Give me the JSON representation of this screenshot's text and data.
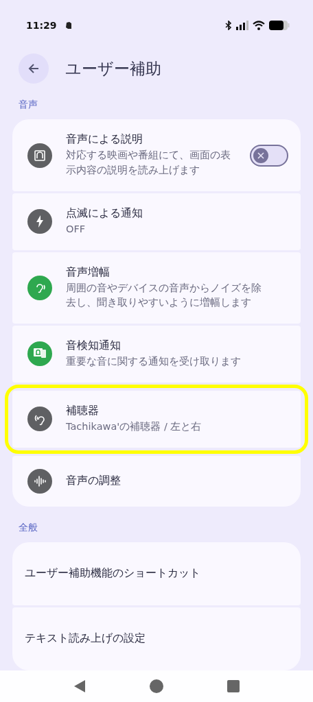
{
  "status_bar": {
    "time": "11:29"
  },
  "header": {
    "title": "ユーザー補助"
  },
  "sections": [
    {
      "title": "音声",
      "items": [
        {
          "title": "音声による説明",
          "subtitle": "対応する映画や番組にて、画面の表示内容の説明を読み上げます",
          "color": "#5f6063",
          "toggle": {
            "checked": false
          },
          "highlighted": false
        },
        {
          "title": "点滅による通知",
          "subtitle": "OFF",
          "color": "#5f6063",
          "highlighted": false
        },
        {
          "title": "音声増幅",
          "subtitle": "周囲の音やデバイスの音声からノイズを除去し、聞き取りやすいように増幅します",
          "color": "#2ea84f",
          "highlighted": false
        },
        {
          "title": "音検知通知",
          "subtitle": "重要な音に関する通知を受け取ります",
          "color": "#2ea84f",
          "highlighted": false
        },
        {
          "title": "補聴器",
          "subtitle": "Tachikawa'の補聴器 / 左と右",
          "color": "#5f6063",
          "highlighted": true
        },
        {
          "title": "音声の調整",
          "color": "#5f6063",
          "highlighted": false
        }
      ]
    },
    {
      "title": "全般",
      "items": [
        {
          "title": "ユーザー補助機能のショートカット",
          "highlighted": false
        },
        {
          "title": "テキスト読み上げの設定",
          "highlighted": false
        }
      ]
    }
  ]
}
